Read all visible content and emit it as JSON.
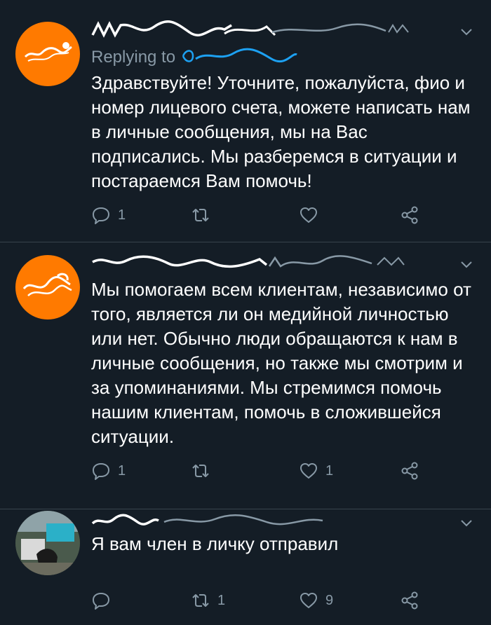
{
  "tweets": [
    {
      "replying_label": "Replying to",
      "text": "Здравствуйте! Уточните, пожалуйста, фио и номер лицевого счета, можете написать нам в личные сообщения, мы на Вас подписались. Мы разберемся в ситуации и постараемся Вам помочь!",
      "reply_count": "1",
      "retweet_count": "",
      "like_count": ""
    },
    {
      "text": "Мы помогаем всем клиентам, независимо от того, является ли он медийной личностью или нет. Обычно люди обращаются к нам в личные сообщения, но также мы смотрим и за упоминаниями. Мы стремимся помочь нашим клиентам, помочь в сложившейся ситуации.",
      "reply_count": "1",
      "retweet_count": "",
      "like_count": "1"
    },
    {
      "text": "Я вам член в личку отправил",
      "reply_count": "",
      "retweet_count": "1",
      "like_count": "9"
    }
  ],
  "colors": {
    "background": "#141d26",
    "divider": "#38444d",
    "secondary_text": "#8899a6",
    "link": "#1da1f2",
    "brand_orange": "#ff7a00"
  },
  "icons": [
    "reply-icon",
    "retweet-icon",
    "like-icon",
    "share-icon",
    "chevron-down-icon"
  ]
}
